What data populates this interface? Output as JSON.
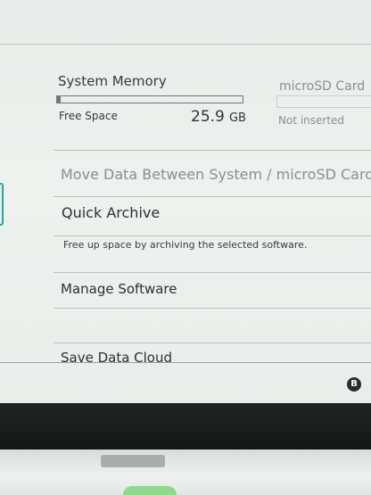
{
  "storage": {
    "system_memory": {
      "title": "System Memory",
      "free_label": "Free Space",
      "free_value": "25.9",
      "free_unit": "GB",
      "used_fraction": 0.01
    },
    "microsd": {
      "title": "microSD Card",
      "status": "Not inserted"
    }
  },
  "menu": {
    "move_data": "Move Data Between System / microSD Card",
    "quick_archive": "Quick Archive",
    "quick_archive_desc": "Free up space by archiving the selected software.",
    "manage_software": "Manage Software",
    "save_data_cloud": "Save Data Cloud"
  },
  "footer": {
    "back_button": "B"
  },
  "colors": {
    "accent": "#27a5a0",
    "text": "#3a3a3a",
    "muted": "#8a8f8d"
  }
}
